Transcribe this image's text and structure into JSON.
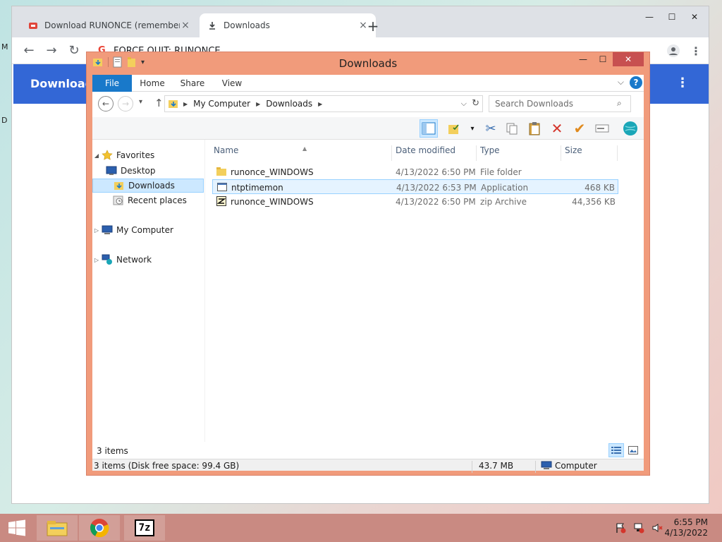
{
  "browser": {
    "tabs": [
      {
        "title": "Download RUNONCE (remember",
        "close": "×"
      },
      {
        "title": "Downloads",
        "close": "×"
      }
    ],
    "new_tab": "+",
    "window_controls": {
      "minimize": "—",
      "maximize": "☐",
      "close": "✕"
    },
    "omnibox_text": "FORCE QUIT: RUNONCE",
    "page_header_title": "Downloads",
    "page_menu": "⋮"
  },
  "explorer": {
    "title": "Downloads",
    "ribbon_tabs": {
      "file": "File",
      "home": "Home",
      "share": "Share",
      "view": "View"
    },
    "help": "?",
    "address": {
      "root": "My Computer",
      "current": "Downloads"
    },
    "search_placeholder": "Search Downloads",
    "nav": {
      "favorites": "Favorites",
      "desktop": "Desktop",
      "downloads": "Downloads",
      "recent": "Recent places",
      "computer": "My Computer",
      "network": "Network"
    },
    "columns": {
      "name": "Name",
      "date": "Date modified",
      "type": "Type",
      "size": "Size"
    },
    "files": [
      {
        "name": "runonce_WINDOWS",
        "date": "4/13/2022 6:50 PM",
        "type": "File folder",
        "size": ""
      },
      {
        "name": "ntptimemon",
        "date": "4/13/2022 6:53 PM",
        "type": "Application",
        "size": "468 KB"
      },
      {
        "name": "runonce_WINDOWS",
        "date": "4/13/2022 6:50 PM",
        "type": "zip Archive",
        "size": "44,356 KB"
      }
    ],
    "status_count": "3 items",
    "status_detail": "3 items (Disk free space: 99.4 GB)",
    "status_size": "43.7 MB",
    "status_location": "Computer"
  },
  "taskbar": {
    "app_7zip_label": "7z",
    "time": "6:55 PM",
    "date": "4/13/2022"
  },
  "desktop_edge": [
    "M",
    "D"
  ]
}
